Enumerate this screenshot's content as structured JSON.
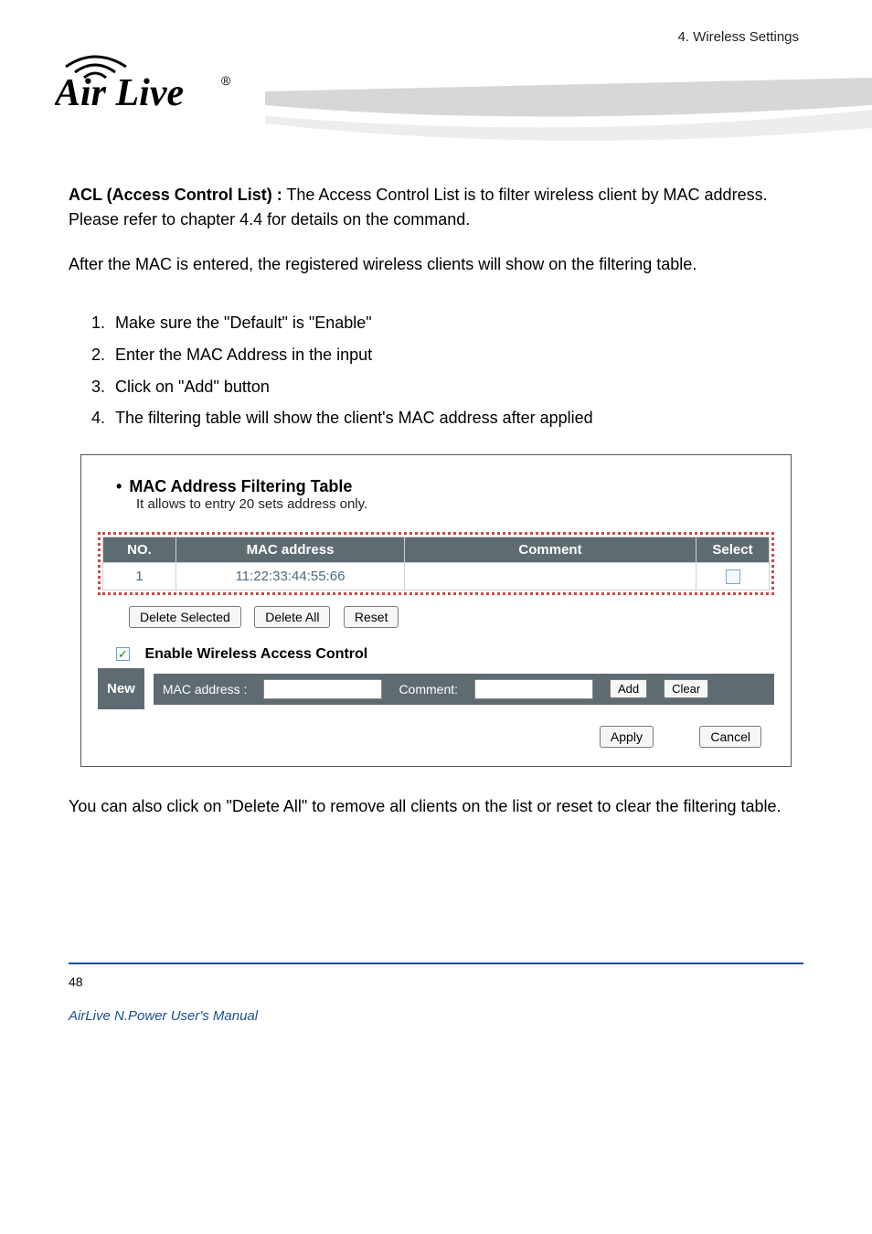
{
  "header": {
    "logo_text": "Air Live",
    "chapter": "4. Wireless Settings"
  },
  "intro": {
    "title_label": "ACL (Access Control List) :",
    "title_text": "The Access Control List is to filter wireless client by MAC address. Please refer to chapter 4.4 for details on the command.",
    "p2": "After the MAC is entered, the registered wireless clients will show on the filtering table."
  },
  "steps": [
    "Make sure the \"Default\" is \"Enable\"",
    "Enter the MAC Address in the input",
    "Click on \"Add\" button",
    "The filtering table will show the client's MAC address after applied"
  ],
  "panel": {
    "title": "MAC Address Filtering Table",
    "subtitle": "It allows to entry 20 sets address only.",
    "cols": {
      "no": "NO.",
      "mac": "MAC address",
      "comment": "Comment",
      "select": "Select"
    },
    "row": {
      "no": "1",
      "mac": "11:22:33:44:55:66",
      "comment": ""
    },
    "buttons": {
      "delete_selected": "Delete Selected",
      "delete_all": "Delete All",
      "reset": "Reset"
    },
    "enable_label": "Enable Wireless Access Control",
    "new_label": "New",
    "mac_label": "MAC address :",
    "comment_label": "Comment:",
    "add": "Add",
    "clear": "Clear",
    "apply": "Apply",
    "cancel": "Cancel"
  },
  "after": "You can also click on \"Delete All\" to remove all clients on the list or reset to clear the filtering table.",
  "footer": {
    "page": "48",
    "manual1": "AirLive N.Power User's Manual"
  }
}
